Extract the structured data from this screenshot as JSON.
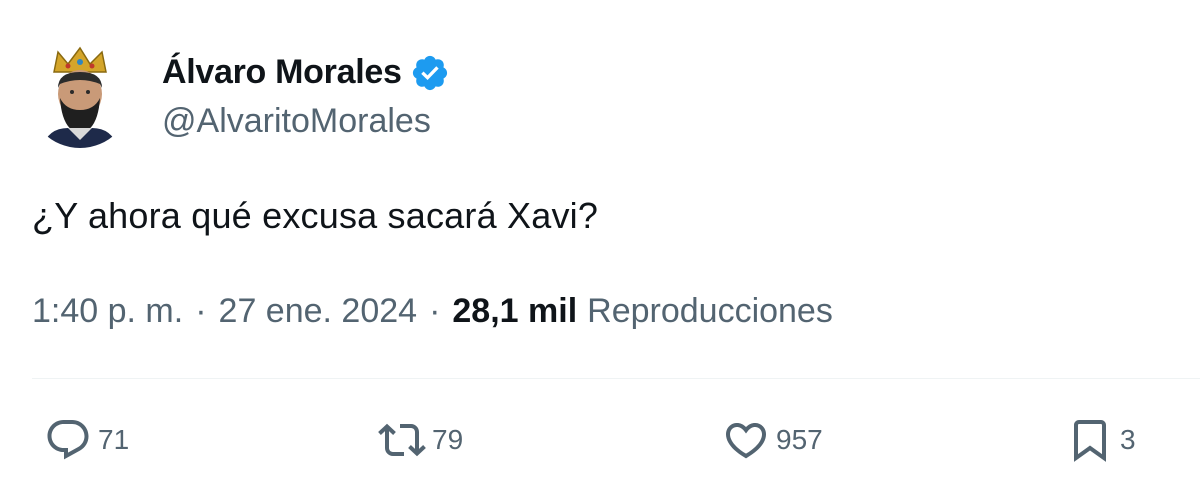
{
  "author": {
    "display_name": "Álvaro Morales",
    "handle": "@AlvaritoMorales",
    "verified": true
  },
  "tweet": {
    "text": "¿Y ahora qué excusa sacará Xavi?",
    "time": "1:40 p. m.",
    "date": "27 ene. 2024",
    "separator": "·",
    "views_count": "28,1 mil",
    "views_label": "Reproducciones"
  },
  "actions": {
    "replies": "71",
    "retweets": "79",
    "likes": "957",
    "bookmarks": "3"
  },
  "colors": {
    "primary_text": "#0f1419",
    "secondary_text": "#536471",
    "verified_badge": "#1d9bf0",
    "divider": "#eff3f4"
  }
}
